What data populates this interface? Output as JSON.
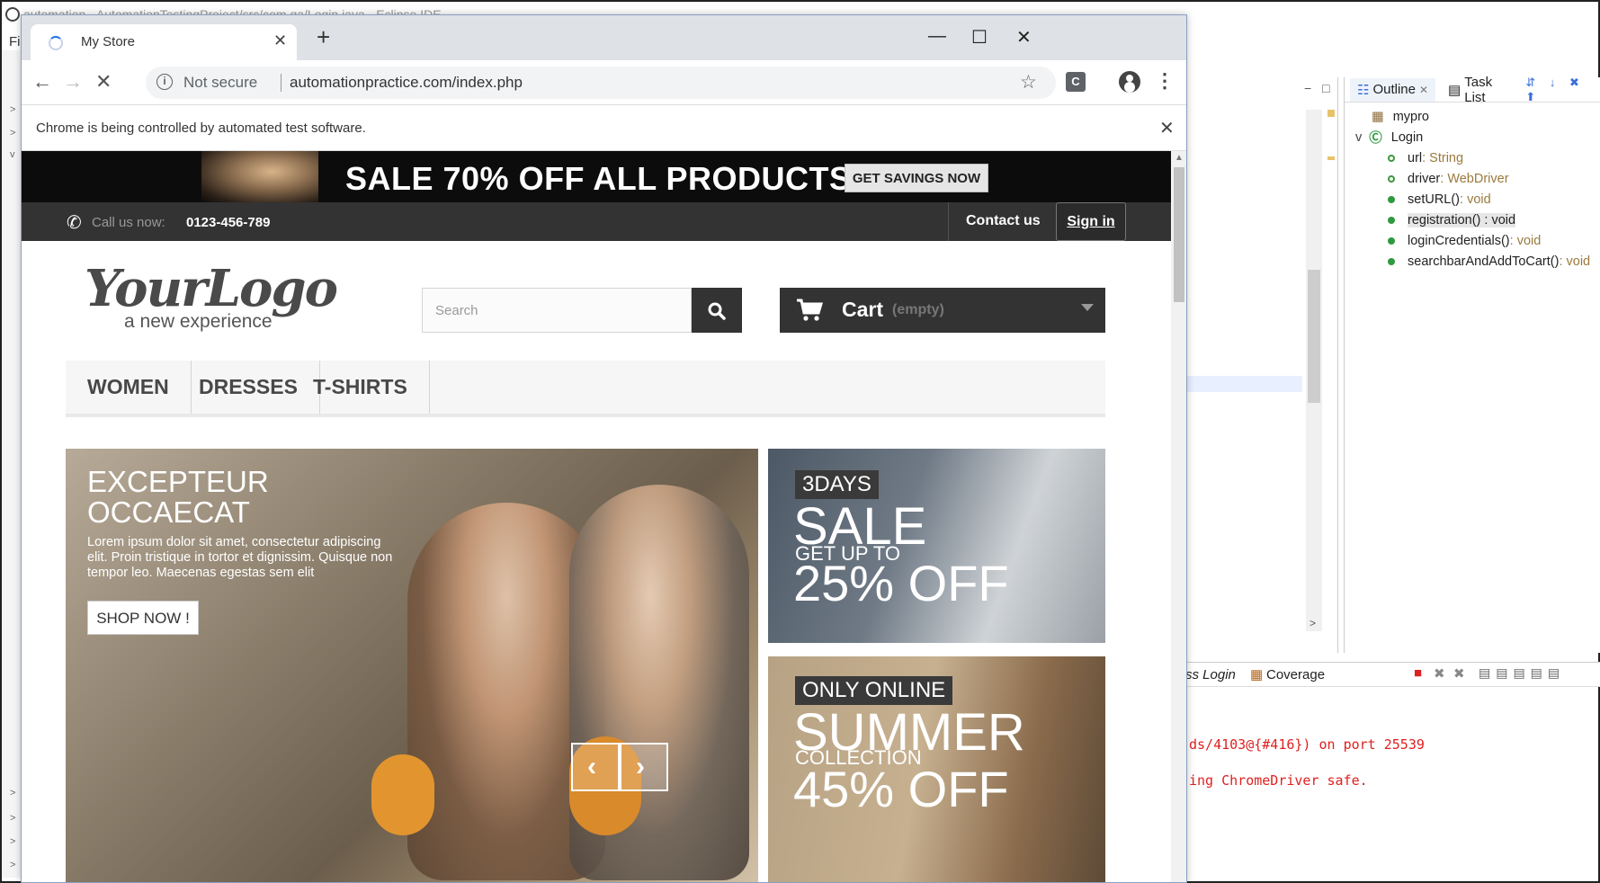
{
  "eclipse": {
    "title": "automation - AutomationTestingProject/src/com.qa/Login.java - Eclipse IDE",
    "menu_letters": "Fi",
    "outline_tab": "Outline",
    "tasklist_tab": "Task List",
    "tree": [
      {
        "name": "mypro",
        "type": ""
      },
      {
        "name": "Login",
        "type": ""
      },
      {
        "name": "url",
        "type": " : String"
      },
      {
        "name": "driver",
        "type": " : WebDriver"
      },
      {
        "name": "setURL()",
        "type": " : void"
      },
      {
        "name": "registration() : void",
        "type": ""
      },
      {
        "name": "loginCredentials()",
        "type": " : void"
      },
      {
        "name": "searchbarAndAddToCart()",
        "type": " : void"
      }
    ],
    "console_tabs": [
      "ss Login",
      "Coverage"
    ],
    "console_lines": [
      "ds/4103@{#416}) on port 25539",
      "ing ChromeDriver safe."
    ]
  },
  "chrome": {
    "tab_title": "My Store",
    "omnibox_security": "Not secure",
    "omnibox_url": "automationpractice.com/index.php",
    "extension_letter": "C",
    "infobar_text": "Chrome is being controlled by automated test software."
  },
  "store": {
    "banner_text": "SALE 70% OFF ALL PRODUCTS",
    "banner_button": "GET SAVINGS NOW",
    "call_label": "Call us now:",
    "call_number": "0123-456-789",
    "contact_link": "Contact us",
    "signin_link": "Sign in",
    "logo_main": "YourLogo",
    "logo_sub": "a new experience",
    "search_placeholder": "Search",
    "cart_label": "Cart",
    "cart_status": "(empty)",
    "menu": [
      "WOMEN",
      "DRESSES",
      "T-SHIRTS"
    ],
    "slider": {
      "title_line1": "EXCEPTEUR",
      "title_line2": "OCCAECAT",
      "text": "Lorem ipsum dolor sit amet, consectetur adipiscing elit. Proin tristique in tortor et dignissim. Quisque non tempor leo. Maecenas egestas sem elit",
      "button": "SHOP NOW !"
    },
    "promo1": {
      "tag": "3DAYS",
      "big": "SALE",
      "small": "GET UP TO",
      "pct": "25% OFF"
    },
    "promo2": {
      "tag": "ONLY ONLINE",
      "big": "SUMMER",
      "small": "COLLECTION",
      "pct": "45% OFF"
    }
  }
}
